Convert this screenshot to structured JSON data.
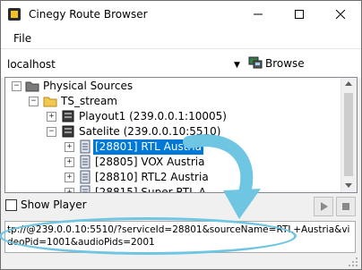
{
  "window": {
    "title": "Cinegy Route Browser"
  },
  "menu": {
    "file": "File"
  },
  "address": {
    "host": "localhost",
    "browse": "Browse"
  },
  "tree": {
    "physical_sources": "Physical Sources",
    "ts_stream": "TS_stream",
    "playout1": "Playout1 (239.0.0.1:10005)",
    "satelite": "Satelite (239.0.0.10:5510)",
    "channels": [
      "[28801] RTL Austria",
      "[28805] VOX Austria",
      "[28810] RTL2 Austria",
      "[28815] Super RTL A"
    ]
  },
  "player": {
    "show_player": "Show Player"
  },
  "url": {
    "text": "tp://@239.0.0.10:5510/?serviceId=28801&sourceName=RTL+Austria&videoPid=1001&audioPids=2001"
  },
  "colors": {
    "selection": "#0078d7",
    "annotation": "#6ec6e2"
  },
  "icons": {
    "app": "cinegy-app-icon",
    "browse": "network-computer-icon",
    "folder": "folder-icon",
    "server": "server-icon",
    "channel": "channel-document-icon"
  }
}
